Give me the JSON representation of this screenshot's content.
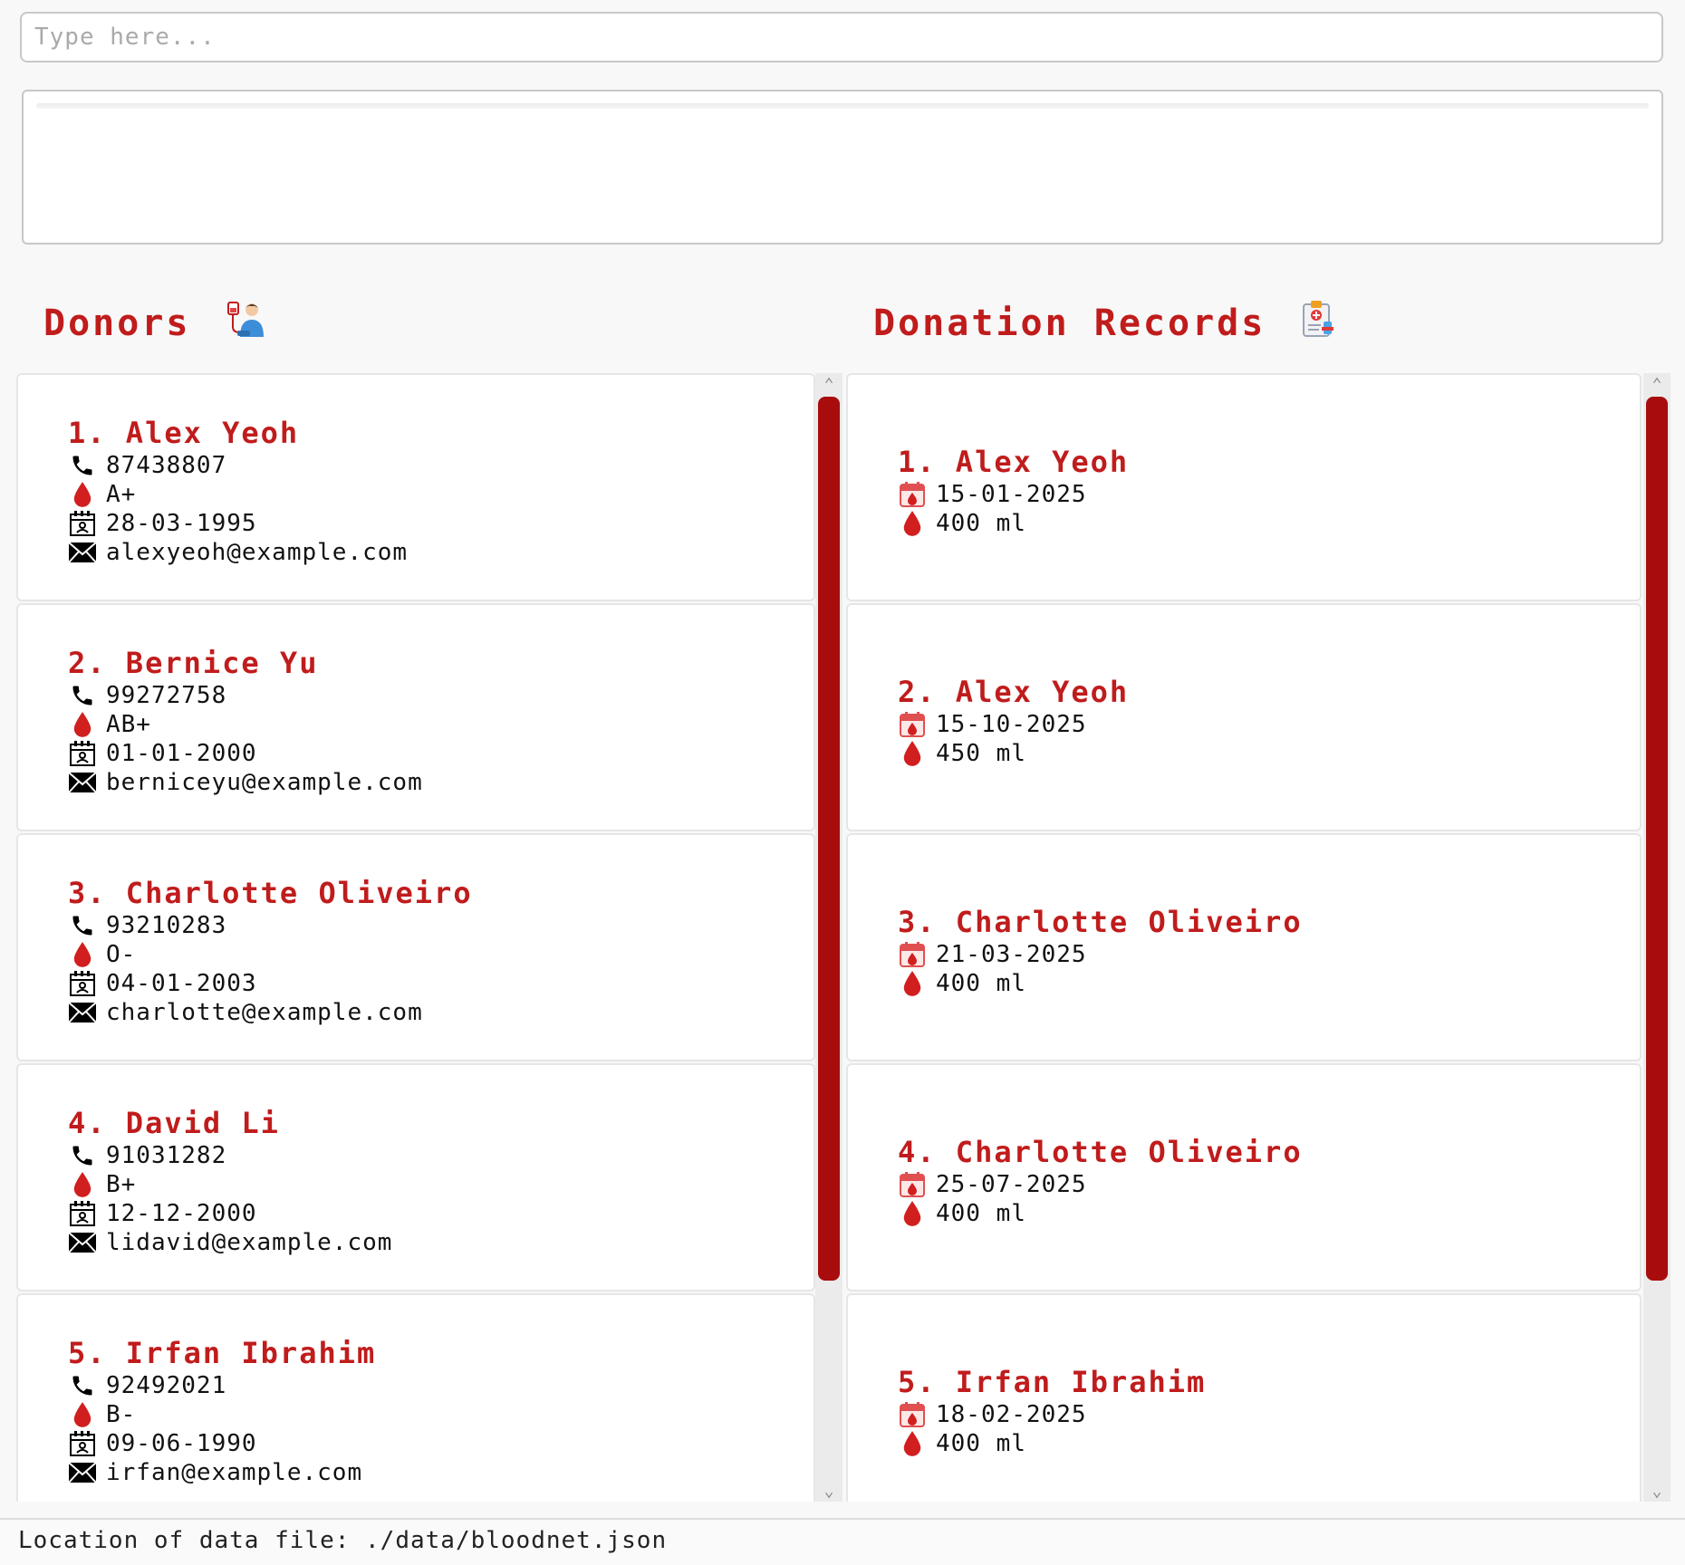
{
  "command_box": {
    "placeholder": "Type here...",
    "value": ""
  },
  "result_display": {
    "text": ""
  },
  "donors_panel": {
    "title": "Donors",
    "icon": "donor-icon",
    "items": [
      {
        "index": "1.",
        "name": "Alex Yeoh",
        "phone": "87438807",
        "blood_type": "A+",
        "dob": "28-03-1995",
        "email": "alexyeoh@example.com"
      },
      {
        "index": "2.",
        "name": "Bernice Yu",
        "phone": "99272758",
        "blood_type": "AB+",
        "dob": "01-01-2000",
        "email": "berniceyu@example.com"
      },
      {
        "index": "3.",
        "name": "Charlotte Oliveiro",
        "phone": "93210283",
        "blood_type": "O-",
        "dob": "04-01-2003",
        "email": "charlotte@example.com"
      },
      {
        "index": "4.",
        "name": "David Li",
        "phone": "91031282",
        "blood_type": "B+",
        "dob": "12-12-2000",
        "email": "lidavid@example.com"
      },
      {
        "index": "5.",
        "name": "Irfan Ibrahim",
        "phone": "92492021",
        "blood_type": "B-",
        "dob": "09-06-1990",
        "email": "irfan@example.com"
      }
    ]
  },
  "records_panel": {
    "title": "Donation Records",
    "icon": "clipboard-icon",
    "items": [
      {
        "index": "1.",
        "name": "Alex Yeoh",
        "date": "15-01-2025",
        "volume": "400 ml"
      },
      {
        "index": "2.",
        "name": "Alex Yeoh",
        "date": "15-10-2025",
        "volume": "450 ml"
      },
      {
        "index": "3.",
        "name": "Charlotte Oliveiro",
        "date": "21-03-2025",
        "volume": "400 ml"
      },
      {
        "index": "4.",
        "name": "Charlotte Oliveiro",
        "date": "25-07-2025",
        "volume": "400 ml"
      },
      {
        "index": "5.",
        "name": "Irfan Ibrahim",
        "date": "18-02-2025",
        "volume": "400 ml"
      }
    ]
  },
  "status_bar": {
    "text": "Location of data file: ./data/bloodnet.json"
  },
  "colors": {
    "accent": "#c01c1c",
    "scroll_thumb": "#a80c0c",
    "background": "#f8f8f8"
  }
}
